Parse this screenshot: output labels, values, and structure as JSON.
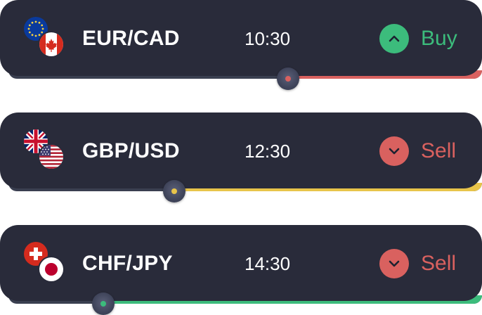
{
  "trades": [
    {
      "pair": "EUR/CAD",
      "time": "10:30",
      "action": "Buy",
      "action_color": "#3cbc7c",
      "action_icon": "chevron-up-icon",
      "base_flag": "eu-flag-icon",
      "quote_flag": "canada-flag-icon",
      "progress_color": "#d9615f",
      "progress": 0.59
    },
    {
      "pair": "GBP/USD",
      "time": "12:30",
      "action": "Sell",
      "action_color": "#d9615f",
      "action_icon": "chevron-down-icon",
      "base_flag": "uk-flag-icon",
      "quote_flag": "usa-flag-icon",
      "progress_color": "#e8c44a",
      "progress": 0.35
    },
    {
      "pair": "CHF/JPY",
      "time": "14:30",
      "action": "Sell",
      "action_color": "#d9615f",
      "action_icon": "chevron-down-icon",
      "base_flag": "switzerland-flag-icon",
      "quote_flag": "japan-flag-icon",
      "progress_color": "#3cbc7c",
      "progress": 0.2
    }
  ]
}
